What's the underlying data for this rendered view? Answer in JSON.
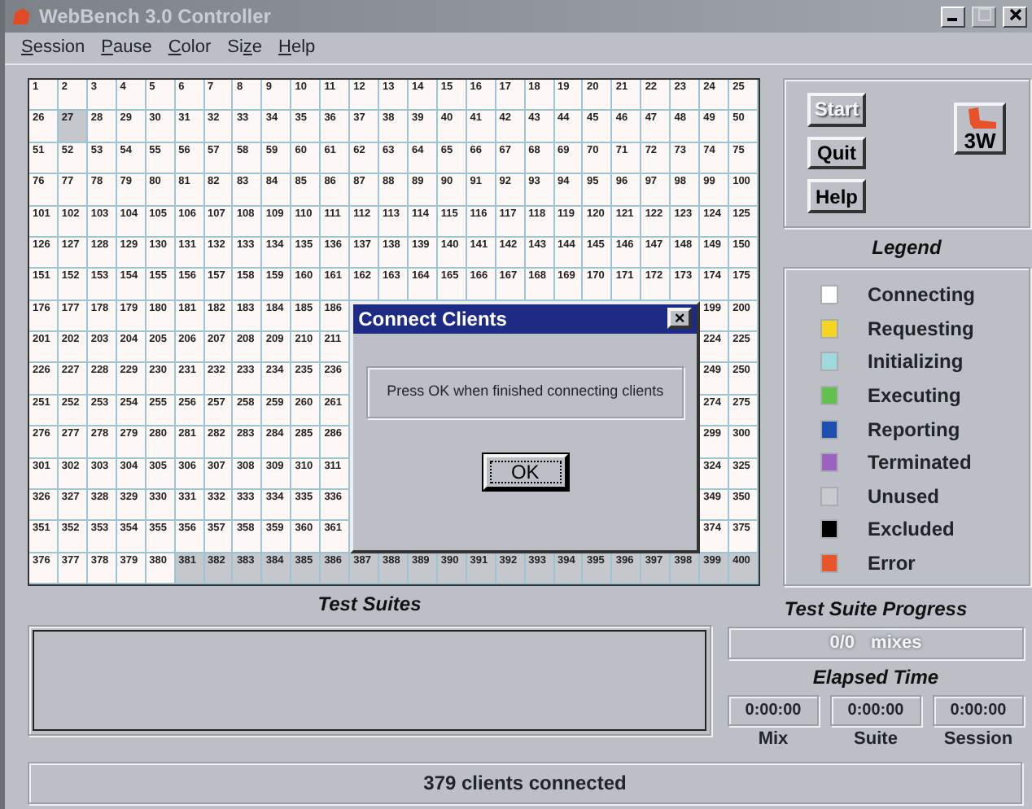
{
  "window": {
    "title": "WebBench 3.0 Controller"
  },
  "menu": [
    {
      "key": "S",
      "after": "ession"
    },
    {
      "key": "P",
      "after": "ause"
    },
    {
      "key": "C",
      "after": "olor"
    },
    {
      "before": "Si",
      "key": "z",
      "after": "e"
    },
    {
      "key": "H",
      "after": "elp"
    }
  ],
  "grid": [
    {
      "cells": [
        {
          "label": "1",
          "color": "#fdf8f6"
        },
        {
          "label": "2",
          "color": "#fdf8f6"
        },
        {
          "label": "3",
          "color": "#fdf8f6"
        },
        {
          "label": "4",
          "color": "#fdf8f6"
        },
        {
          "label": "5",
          "color": "#fdf8f6"
        },
        {
          "label": "6",
          "color": "#fdf8f6"
        },
        {
          "label": "7",
          "color": "#fdf8f6"
        },
        {
          "label": "8",
          "color": "#fdf8f6"
        },
        {
          "label": "9",
          "color": "#fdf8f6"
        },
        {
          "label": "10",
          "color": "#fdf8f6"
        },
        {
          "label": "11",
          "color": "#fdf8f6"
        },
        {
          "label": "12",
          "color": "#fdf8f6"
        },
        {
          "label": "13",
          "color": "#fdf8f6"
        },
        {
          "label": "14",
          "color": "#fdf8f6"
        },
        {
          "label": "15",
          "color": "#fdf8f6"
        },
        {
          "label": "16",
          "color": "#fdf8f6"
        },
        {
          "label": "17",
          "color": "#fdf8f6"
        },
        {
          "label": "18",
          "color": "#fdf8f6"
        },
        {
          "label": "19",
          "color": "#fdf8f6"
        },
        {
          "label": "20",
          "color": "#fdf8f6"
        },
        {
          "label": "21",
          "color": "#fdf8f6"
        },
        {
          "label": "22",
          "color": "#fdf8f6"
        },
        {
          "label": "23",
          "color": "#fdf8f6"
        },
        {
          "label": "24",
          "color": "#fdf8f6"
        },
        {
          "label": "25",
          "color": "#fdf8f6"
        }
      ]
    },
    {
      "cells": [
        {
          "label": "26",
          "color": "#fdf8f6"
        },
        {
          "label": "27",
          "color": "#c4c7cb"
        },
        {
          "label": "28",
          "color": "#fdf8f6"
        },
        {
          "label": "29",
          "color": "#fdf8f6"
        },
        {
          "label": "30",
          "color": "#fdf8f6"
        },
        {
          "label": "31",
          "color": "#fdf8f6"
        },
        {
          "label": "32",
          "color": "#fdf8f6"
        },
        {
          "label": "33",
          "color": "#fdf8f6"
        },
        {
          "label": "34",
          "color": "#fdf8f6"
        },
        {
          "label": "35",
          "color": "#fdf8f6"
        },
        {
          "label": "36",
          "color": "#fdf8f6"
        },
        {
          "label": "37",
          "color": "#fdf8f6"
        },
        {
          "label": "38",
          "color": "#fdf8f6"
        },
        {
          "label": "39",
          "color": "#fdf8f6"
        },
        {
          "label": "40",
          "color": "#fdf8f6"
        },
        {
          "label": "41",
          "color": "#fdf8f6"
        },
        {
          "label": "42",
          "color": "#fdf8f6"
        },
        {
          "label": "43",
          "color": "#fdf8f6"
        },
        {
          "label": "44",
          "color": "#fdf8f6"
        },
        {
          "label": "45",
          "color": "#fdf8f6"
        },
        {
          "label": "46",
          "color": "#fdf8f6"
        },
        {
          "label": "47",
          "color": "#fdf8f6"
        },
        {
          "label": "48",
          "color": "#fdf8f6"
        },
        {
          "label": "49",
          "color": "#fdf8f6"
        },
        {
          "label": "50",
          "color": "#fdf8f6"
        }
      ]
    },
    {
      "cells": [
        {
          "label": "51",
          "color": "#fdf8f6"
        },
        {
          "label": "52",
          "color": "#fdf8f6"
        },
        {
          "label": "53",
          "color": "#fdf8f6"
        },
        {
          "label": "54",
          "color": "#fdf8f6"
        },
        {
          "label": "55",
          "color": "#fdf8f6"
        },
        {
          "label": "56",
          "color": "#fdf8f6"
        },
        {
          "label": "57",
          "color": "#fdf8f6"
        },
        {
          "label": "58",
          "color": "#fdf8f6"
        },
        {
          "label": "59",
          "color": "#fdf8f6"
        },
        {
          "label": "60",
          "color": "#fdf8f6"
        },
        {
          "label": "61",
          "color": "#fdf8f6"
        },
        {
          "label": "62",
          "color": "#fdf8f6"
        },
        {
          "label": "63",
          "color": "#fdf8f6"
        },
        {
          "label": "64",
          "color": "#fdf8f6"
        },
        {
          "label": "65",
          "color": "#fdf8f6"
        },
        {
          "label": "66",
          "color": "#fdf8f6"
        },
        {
          "label": "67",
          "color": "#fdf8f6"
        },
        {
          "label": "68",
          "color": "#fdf8f6"
        },
        {
          "label": "69",
          "color": "#fdf8f6"
        },
        {
          "label": "70",
          "color": "#fdf8f6"
        },
        {
          "label": "71",
          "color": "#fdf8f6"
        },
        {
          "label": "72",
          "color": "#fdf8f6"
        },
        {
          "label": "73",
          "color": "#fdf8f6"
        },
        {
          "label": "74",
          "color": "#fdf8f6"
        },
        {
          "label": "75",
          "color": "#fdf8f6"
        }
      ]
    },
    {
      "cells": [
        {
          "label": "76",
          "color": "#fdf8f6"
        },
        {
          "label": "77",
          "color": "#fdf8f6"
        },
        {
          "label": "78",
          "color": "#fdf8f6"
        },
        {
          "label": "79",
          "color": "#fdf8f6"
        },
        {
          "label": "80",
          "color": "#fdf8f6"
        },
        {
          "label": "81",
          "color": "#fdf8f6"
        },
        {
          "label": "82",
          "color": "#fdf8f6"
        },
        {
          "label": "83",
          "color": "#fdf8f6"
        },
        {
          "label": "84",
          "color": "#fdf8f6"
        },
        {
          "label": "85",
          "color": "#fdf8f6"
        },
        {
          "label": "86",
          "color": "#fdf8f6"
        },
        {
          "label": "87",
          "color": "#fdf8f6"
        },
        {
          "label": "88",
          "color": "#fdf8f6"
        },
        {
          "label": "89",
          "color": "#fdf8f6"
        },
        {
          "label": "90",
          "color": "#fdf8f6"
        },
        {
          "label": "91",
          "color": "#fdf8f6"
        },
        {
          "label": "92",
          "color": "#fdf8f6"
        },
        {
          "label": "93",
          "color": "#fdf8f6"
        },
        {
          "label": "94",
          "color": "#fdf8f6"
        },
        {
          "label": "95",
          "color": "#fdf8f6"
        },
        {
          "label": "96",
          "color": "#fdf8f6"
        },
        {
          "label": "97",
          "color": "#fdf8f6"
        },
        {
          "label": "98",
          "color": "#fdf8f6"
        },
        {
          "label": "99",
          "color": "#fdf8f6"
        },
        {
          "label": "100",
          "color": "#fdf8f6"
        }
      ]
    },
    {
      "cells": [
        {
          "label": "101",
          "color": "#fdf8f6"
        },
        {
          "label": "102",
          "color": "#fdf8f6"
        },
        {
          "label": "103",
          "color": "#fdf8f6"
        },
        {
          "label": "104",
          "color": "#fdf8f6"
        },
        {
          "label": "105",
          "color": "#fdf8f6"
        },
        {
          "label": "106",
          "color": "#fdf8f6"
        },
        {
          "label": "107",
          "color": "#fdf8f6"
        },
        {
          "label": "108",
          "color": "#fdf8f6"
        },
        {
          "label": "109",
          "color": "#fdf8f6"
        },
        {
          "label": "110",
          "color": "#fdf8f6"
        },
        {
          "label": "111",
          "color": "#fdf8f6"
        },
        {
          "label": "112",
          "color": "#fdf8f6"
        },
        {
          "label": "113",
          "color": "#fdf8f6"
        },
        {
          "label": "114",
          "color": "#fdf8f6"
        },
        {
          "label": "115",
          "color": "#fdf8f6"
        },
        {
          "label": "116",
          "color": "#fdf8f6"
        },
        {
          "label": "117",
          "color": "#fdf8f6"
        },
        {
          "label": "118",
          "color": "#fdf8f6"
        },
        {
          "label": "119",
          "color": "#fdf8f6"
        },
        {
          "label": "120",
          "color": "#fdf8f6"
        },
        {
          "label": "121",
          "color": "#fdf8f6"
        },
        {
          "label": "122",
          "color": "#fdf8f6"
        },
        {
          "label": "123",
          "color": "#fdf8f6"
        },
        {
          "label": "124",
          "color": "#fdf8f6"
        },
        {
          "label": "125",
          "color": "#fdf8f6"
        }
      ]
    },
    {
      "cells": [
        {
          "label": "126",
          "color": "#fdf8f6"
        },
        {
          "label": "127",
          "color": "#fdf8f6"
        },
        {
          "label": "128",
          "color": "#fdf8f6"
        },
        {
          "label": "129",
          "color": "#fdf8f6"
        },
        {
          "label": "130",
          "color": "#fdf8f6"
        },
        {
          "label": "131",
          "color": "#fdf8f6"
        },
        {
          "label": "132",
          "color": "#fdf8f6"
        },
        {
          "label": "133",
          "color": "#fdf8f6"
        },
        {
          "label": "134",
          "color": "#fdf8f6"
        },
        {
          "label": "135",
          "color": "#fdf8f6"
        },
        {
          "label": "136",
          "color": "#fdf8f6"
        },
        {
          "label": "137",
          "color": "#fdf8f6"
        },
        {
          "label": "138",
          "color": "#fdf8f6"
        },
        {
          "label": "139",
          "color": "#fdf8f6"
        },
        {
          "label": "140",
          "color": "#fdf8f6"
        },
        {
          "label": "141",
          "color": "#fdf8f6"
        },
        {
          "label": "142",
          "color": "#fdf8f6"
        },
        {
          "label": "143",
          "color": "#fdf8f6"
        },
        {
          "label": "144",
          "color": "#fdf8f6"
        },
        {
          "label": "145",
          "color": "#fdf8f6"
        },
        {
          "label": "146",
          "color": "#fdf8f6"
        },
        {
          "label": "147",
          "color": "#fdf8f6"
        },
        {
          "label": "148",
          "color": "#fdf8f6"
        },
        {
          "label": "149",
          "color": "#fdf8f6"
        },
        {
          "label": "150",
          "color": "#fdf8f6"
        }
      ]
    },
    {
      "cells": [
        {
          "label": "151",
          "color": "#fdf8f6"
        },
        {
          "label": "152",
          "color": "#fdf8f6"
        },
        {
          "label": "153",
          "color": "#fdf8f6"
        },
        {
          "label": "154",
          "color": "#fdf8f6"
        },
        {
          "label": "155",
          "color": "#fdf8f6"
        },
        {
          "label": "156",
          "color": "#fdf8f6"
        },
        {
          "label": "157",
          "color": "#fdf8f6"
        },
        {
          "label": "158",
          "color": "#fdf8f6"
        },
        {
          "label": "159",
          "color": "#fdf8f6"
        },
        {
          "label": "160",
          "color": "#fdf8f6"
        },
        {
          "label": "161",
          "color": "#fdf8f6"
        },
        {
          "label": "162",
          "color": "#fdf8f6"
        },
        {
          "label": "163",
          "color": "#fdf8f6"
        },
        {
          "label": "164",
          "color": "#fdf8f6"
        },
        {
          "label": "165",
          "color": "#fdf8f6"
        },
        {
          "label": "166",
          "color": "#fdf8f6"
        },
        {
          "label": "167",
          "color": "#fdf8f6"
        },
        {
          "label": "168",
          "color": "#fdf8f6"
        },
        {
          "label": "169",
          "color": "#fdf8f6"
        },
        {
          "label": "170",
          "color": "#fdf8f6"
        },
        {
          "label": "171",
          "color": "#fdf8f6"
        },
        {
          "label": "172",
          "color": "#fdf8f6"
        },
        {
          "label": "173",
          "color": "#fdf8f6"
        },
        {
          "label": "174",
          "color": "#fdf8f6"
        },
        {
          "label": "175",
          "color": "#fdf8f6"
        }
      ]
    },
    {
      "cells": [
        {
          "label": "176",
          "color": "#fdf8f6"
        },
        {
          "label": "177",
          "color": "#fdf8f6"
        },
        {
          "label": "178",
          "color": "#fdf8f6"
        },
        {
          "label": "179",
          "color": "#fdf8f6"
        },
        {
          "label": "180",
          "color": "#fdf8f6"
        },
        {
          "label": "181",
          "color": "#fdf8f6"
        },
        {
          "label": "182",
          "color": "#fdf8f6"
        },
        {
          "label": "183",
          "color": "#fdf8f6"
        },
        {
          "label": "184",
          "color": "#fdf8f6"
        },
        {
          "label": "185",
          "color": "#fdf8f6"
        },
        {
          "label": "186",
          "color": "#fdf8f6"
        }
      ],
      "cells_after_dialog": [
        {
          "label": "199",
          "color": "#fdf8f6"
        },
        {
          "label": "200",
          "color": "#fdf8f6"
        }
      ]
    },
    {
      "cells": [
        {
          "label": "201",
          "color": "#fdf8f6"
        },
        {
          "label": "202",
          "color": "#fdf8f6"
        },
        {
          "label": "203",
          "color": "#fdf8f6"
        },
        {
          "label": "204",
          "color": "#fdf8f6"
        },
        {
          "label": "205",
          "color": "#fdf8f6"
        },
        {
          "label": "206",
          "color": "#fdf8f6"
        },
        {
          "label": "207",
          "color": "#fdf8f6"
        },
        {
          "label": "208",
          "color": "#fdf8f6"
        },
        {
          "label": "209",
          "color": "#fdf8f6"
        },
        {
          "label": "210",
          "color": "#fdf8f6"
        },
        {
          "label": "211",
          "color": "#fdf8f6"
        }
      ],
      "cells_after_dialog": [
        {
          "label": "224",
          "color": "#fdf8f6"
        },
        {
          "label": "225",
          "color": "#fdf8f6"
        }
      ]
    },
    {
      "cells": [
        {
          "label": "226",
          "color": "#fdf8f6"
        },
        {
          "label": "227",
          "color": "#fdf8f6"
        },
        {
          "label": "228",
          "color": "#fdf8f6"
        },
        {
          "label": "229",
          "color": "#fdf8f6"
        },
        {
          "label": "230",
          "color": "#fdf8f6"
        },
        {
          "label": "231",
          "color": "#fdf8f6"
        },
        {
          "label": "232",
          "color": "#fdf8f6"
        },
        {
          "label": "233",
          "color": "#fdf8f6"
        },
        {
          "label": "234",
          "color": "#fdf8f6"
        },
        {
          "label": "235",
          "color": "#fdf8f6"
        },
        {
          "label": "236",
          "color": "#fdf8f6"
        }
      ],
      "cells_after_dialog": [
        {
          "label": "249",
          "color": "#fdf8f6"
        },
        {
          "label": "250",
          "color": "#fdf8f6"
        }
      ]
    },
    {
      "cells": [
        {
          "label": "251",
          "color": "#fdf8f6"
        },
        {
          "label": "252",
          "color": "#fdf8f6"
        },
        {
          "label": "253",
          "color": "#fdf8f6"
        },
        {
          "label": "254",
          "color": "#fdf8f6"
        },
        {
          "label": "255",
          "color": "#fdf8f6"
        },
        {
          "label": "256",
          "color": "#fdf8f6"
        },
        {
          "label": "257",
          "color": "#fdf8f6"
        },
        {
          "label": "258",
          "color": "#fdf8f6"
        },
        {
          "label": "259",
          "color": "#fdf8f6"
        },
        {
          "label": "260",
          "color": "#fdf8f6"
        },
        {
          "label": "261",
          "color": "#fdf8f6"
        }
      ],
      "cells_after_dialog": [
        {
          "label": "274",
          "color": "#fdf8f6"
        },
        {
          "label": "275",
          "color": "#fdf8f6"
        }
      ]
    },
    {
      "cells": [
        {
          "label": "276",
          "color": "#fdf8f6"
        },
        {
          "label": "277",
          "color": "#fdf8f6"
        },
        {
          "label": "278",
          "color": "#fdf8f6"
        },
        {
          "label": "279",
          "color": "#fdf8f6"
        },
        {
          "label": "280",
          "color": "#fdf8f6"
        },
        {
          "label": "281",
          "color": "#fdf8f6"
        },
        {
          "label": "282",
          "color": "#fdf8f6"
        },
        {
          "label": "283",
          "color": "#fdf8f6"
        },
        {
          "label": "284",
          "color": "#fdf8f6"
        },
        {
          "label": "285",
          "color": "#fdf8f6"
        },
        {
          "label": "286",
          "color": "#fdf8f6"
        }
      ],
      "cells_after_dialog": [
        {
          "label": "299",
          "color": "#fdf8f6"
        },
        {
          "label": "300",
          "color": "#fdf8f6"
        }
      ]
    },
    {
      "cells": [
        {
          "label": "301",
          "color": "#fdf8f6"
        },
        {
          "label": "302",
          "color": "#fdf8f6"
        },
        {
          "label": "303",
          "color": "#fdf8f6"
        },
        {
          "label": "304",
          "color": "#fdf8f6"
        },
        {
          "label": "305",
          "color": "#fdf8f6"
        },
        {
          "label": "306",
          "color": "#fdf8f6"
        },
        {
          "label": "307",
          "color": "#fdf8f6"
        },
        {
          "label": "308",
          "color": "#fdf8f6"
        },
        {
          "label": "309",
          "color": "#fdf8f6"
        },
        {
          "label": "310",
          "color": "#fdf8f6"
        },
        {
          "label": "311",
          "color": "#fdf8f6"
        }
      ],
      "cells_after_dialog": [
        {
          "label": "324",
          "color": "#fdf8f6"
        },
        {
          "label": "325",
          "color": "#fdf8f6"
        }
      ]
    },
    {
      "cells": [
        {
          "label": "326",
          "color": "#fdf8f6"
        },
        {
          "label": "327",
          "color": "#fdf8f6"
        },
        {
          "label": "328",
          "color": "#fdf8f6"
        },
        {
          "label": "329",
          "color": "#fdf8f6"
        },
        {
          "label": "330",
          "color": "#fdf8f6"
        },
        {
          "label": "331",
          "color": "#fdf8f6"
        },
        {
          "label": "332",
          "color": "#fdf8f6"
        },
        {
          "label": "333",
          "color": "#fdf8f6"
        },
        {
          "label": "334",
          "color": "#fdf8f6"
        },
        {
          "label": "335",
          "color": "#fdf8f6"
        },
        {
          "label": "336",
          "color": "#fdf8f6"
        }
      ],
      "cells_after_dialog": [
        {
          "label": "349",
          "color": "#fdf8f6"
        },
        {
          "label": "350",
          "color": "#fdf8f6"
        }
      ]
    },
    {
      "cells": [
        {
          "label": "351",
          "color": "#fdf8f6"
        },
        {
          "label": "352",
          "color": "#fdf8f6"
        },
        {
          "label": "353",
          "color": "#fdf8f6"
        },
        {
          "label": "354",
          "color": "#fdf8f6"
        },
        {
          "label": "355",
          "color": "#fdf8f6"
        },
        {
          "label": "356",
          "color": "#fdf8f6"
        },
        {
          "label": "357",
          "color": "#fdf8f6"
        },
        {
          "label": "358",
          "color": "#fdf8f6"
        },
        {
          "label": "359",
          "color": "#fdf8f6"
        },
        {
          "label": "360",
          "color": "#fdf8f6"
        },
        {
          "label": "361",
          "color": "#fdf8f6"
        }
      ],
      "cells_after_dialog": [
        {
          "label": "374",
          "color": "#fdf8f6"
        },
        {
          "label": "375",
          "color": "#fdf8f6"
        }
      ]
    },
    {
      "cells": [
        {
          "label": "376",
          "color": "#fdf8f6"
        },
        {
          "label": "377",
          "color": "#fdf8f6"
        },
        {
          "label": "378",
          "color": "#fdf8f6"
        },
        {
          "label": "379",
          "color": "#fdf8f6"
        },
        {
          "label": "380",
          "color": "#fdf8f6"
        },
        {
          "label": "381",
          "color": "#c4c7cb"
        },
        {
          "label": "382",
          "color": "#c4c7cb"
        },
        {
          "label": "383",
          "color": "#c4c7cb"
        },
        {
          "label": "384",
          "color": "#c4c7cb"
        },
        {
          "label": "385",
          "color": "#c4c7cb"
        },
        {
          "label": "386",
          "color": "#c4c7cb"
        },
        {
          "label": "387",
          "color": "#c4c7cb"
        },
        {
          "label": "388",
          "color": "#c4c7cb"
        },
        {
          "label": "389",
          "color": "#c4c7cb"
        },
        {
          "label": "390",
          "color": "#c4c7cb"
        },
        {
          "label": "391",
          "color": "#c4c7cb"
        },
        {
          "label": "392",
          "color": "#c4c7cb"
        },
        {
          "label": "393",
          "color": "#c4c7cb"
        },
        {
          "label": "394",
          "color": "#c4c7cb"
        },
        {
          "label": "395",
          "color": "#c4c7cb"
        },
        {
          "label": "396",
          "color": "#c4c7cb"
        },
        {
          "label": "397",
          "color": "#c4c7cb"
        },
        {
          "label": "398",
          "color": "#c4c7cb"
        },
        {
          "label": "399",
          "color": "#c4c7cb"
        },
        {
          "label": "400",
          "color": "#c4c7cb"
        }
      ]
    }
  ],
  "dialog": {
    "title": "Connect Clients",
    "close": "×",
    "message": "Press OK when finished connecting clients",
    "button": "OK"
  },
  "buttons": [
    {
      "label": "Start",
      "disabled": true
    },
    {
      "label": "Quit",
      "disabled": false
    },
    {
      "label": "Help",
      "disabled": false
    }
  ],
  "logo": {
    "text": "3W"
  },
  "legend": {
    "title": "Legend",
    "items": [
      {
        "label": "Connecting",
        "color": "#ffffff"
      },
      {
        "label": "Requesting",
        "color": "#f6d423"
      },
      {
        "label": "Initializing",
        "color": "#9fd9dc"
      },
      {
        "label": "Executing",
        "color": "#62c04e"
      },
      {
        "label": "Reporting",
        "color": "#1b50b0"
      },
      {
        "label": "Terminated",
        "color": "#9b62c2"
      },
      {
        "label": "Unused",
        "color": "#c8cbce"
      },
      {
        "label": "Excluded",
        "color": "#000000"
      },
      {
        "label": "Error",
        "color": "#e9552b"
      }
    ]
  },
  "test_suites": {
    "title": "Test Suites"
  },
  "progress": {
    "title": "Test Suite Progress",
    "count": "0/0",
    "unit": "mixes"
  },
  "elapsed": {
    "title": "Elapsed Time",
    "timers": [
      {
        "value": "0:00:00",
        "label": "Mix"
      },
      {
        "value": "0:00:00",
        "label": "Suite"
      },
      {
        "value": "0:00:00",
        "label": "Session"
      }
    ]
  },
  "status_bar": "379 clients connected"
}
